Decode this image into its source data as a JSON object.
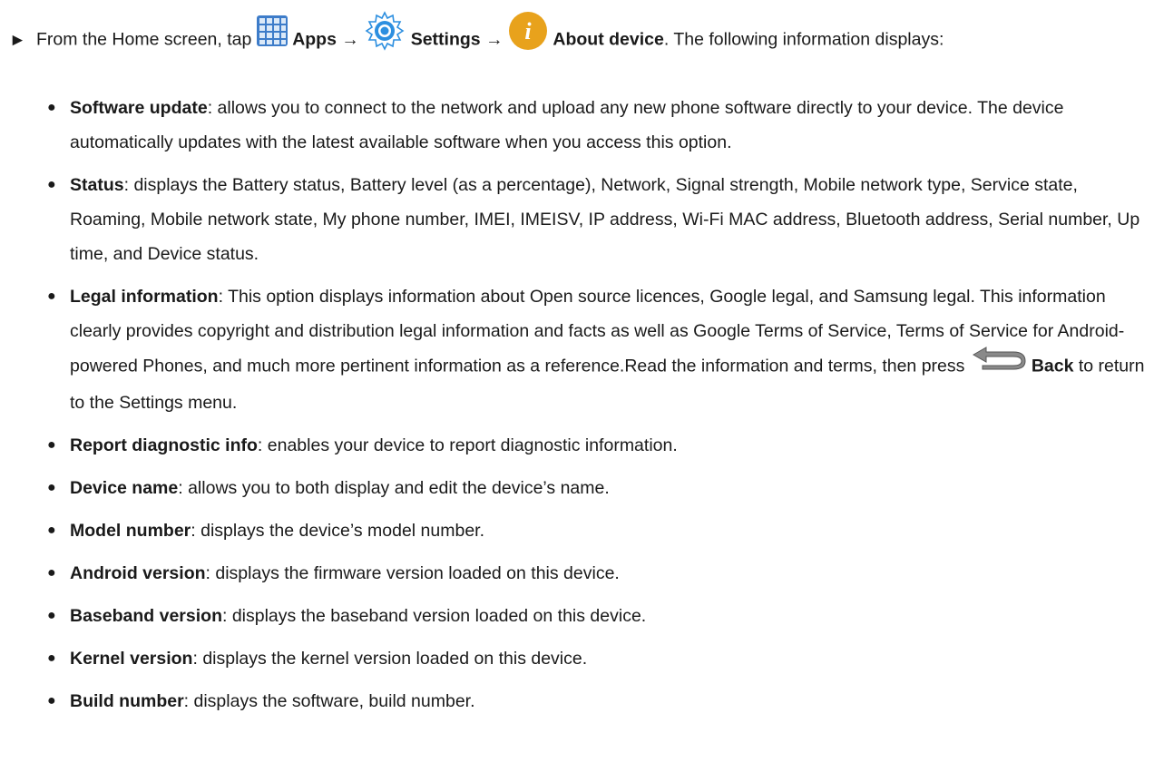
{
  "intro": {
    "pre": "From the Home screen, tap",
    "apps_label": "Apps",
    "arrow1": "→",
    "settings_label": "Settings",
    "arrow2": "→",
    "about_label": "About device",
    "post": ". The following information displays:"
  },
  "items": [
    {
      "term": "Software update",
      "desc": ": allows you to connect to the network and upload any new phone software directly to your device. The device automatically updates with the latest available software when you access this option."
    },
    {
      "term": "Status",
      "desc": ": displays the Battery status, Battery level (as a percentage), Network, Signal strength, Mobile network type, Service state, Roaming, Mobile network state, My phone number, IMEI, IMEISV, IP address, Wi-Fi MAC address, Bluetooth address, Serial number, Up time, and Device status."
    },
    {
      "term": "Legal information",
      "desc": ": This option displays information about Open source licences, Google legal, and Samsung legal. This information clearly provides copyright and distribution legal information and facts as well as Google Terms of Service, Terms of Service for Android-powered Phones, and much more pertinent information as a reference.Read the information and terms, then press",
      "back_label": "Back",
      "desc2": "to return to the Settings menu."
    },
    {
      "term": "Report diagnostic info",
      "desc": ": enables your device to report diagnostic information."
    },
    {
      "term": "Device name",
      "desc": ": allows you to both display and edit the device’s name."
    },
    {
      "term": "Model number",
      "desc": ": displays the device’s model number."
    },
    {
      "term": "Android version",
      "desc": ": displays the firmware version loaded on this device."
    },
    {
      "term": "Baseband version",
      "desc": ": displays the baseband version loaded on this device."
    },
    {
      "term": "Kernel version",
      "desc": ": displays the kernel version loaded on this device."
    },
    {
      "term": "Build number",
      "desc": ": displays the software, build number."
    }
  ],
  "icons": {
    "apps": "apps-grid-icon",
    "settings": "settings-gear-icon",
    "about": "info-icon",
    "back": "back-arrow-icon"
  },
  "colors": {
    "apps_icon": "#3d7cc9",
    "settings_icon": "#2d8fe0",
    "about_icon": "#e8a21c"
  }
}
